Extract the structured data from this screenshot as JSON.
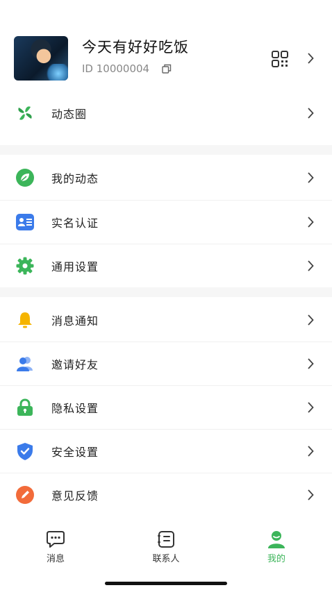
{
  "profile": {
    "nickname": "今天有好好吃饭",
    "id_text": "ID 10000004"
  },
  "moments": {
    "label": "动态圈"
  },
  "menu_group1": [
    {
      "label": "我的动态"
    },
    {
      "label": "实名认证"
    },
    {
      "label": "通用设置"
    }
  ],
  "menu_group2": [
    {
      "label": "消息通知"
    },
    {
      "label": "邀请好友"
    },
    {
      "label": "隐私设置"
    },
    {
      "label": "安全设置"
    },
    {
      "label": "意见反馈"
    }
  ],
  "tabbar": [
    {
      "label": "消息"
    },
    {
      "label": "联系人"
    },
    {
      "label": "我的"
    }
  ],
  "colors": {
    "accent": "#3cb55a",
    "blue": "#3b7bea",
    "yellow": "#f5b400",
    "orange": "#f26b3a"
  }
}
